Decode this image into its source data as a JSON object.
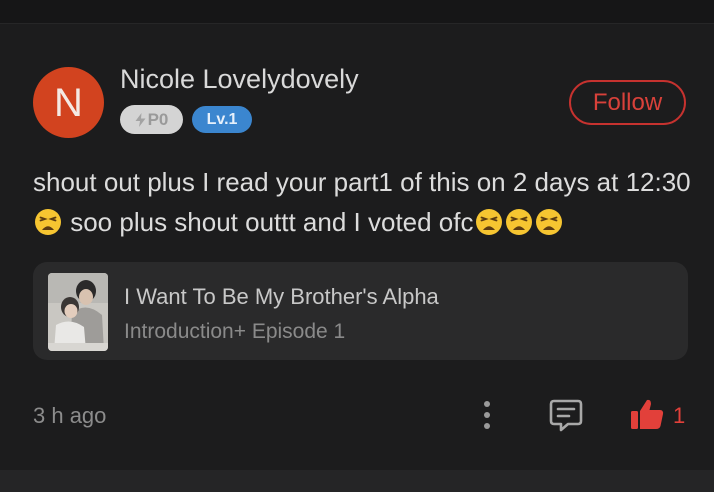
{
  "comment": {
    "avatar_letter": "N",
    "username": "Nicole Lovelydovely",
    "badges": {
      "points": "P0",
      "level": "Lv.1"
    },
    "follow_label": "Follow",
    "text_part1": "shout out plus I read your part1 of this on 2 days at 12:30",
    "text_part2": " soo plus shout outtt and I voted ofc",
    "emoji": "weary-face",
    "timestamp": "3 h ago",
    "likes": "1"
  },
  "story": {
    "title": "I Want To Be My Brother's Alpha",
    "episode": "Introduction+ Episode 1"
  },
  "colors": {
    "background": "#1c1c1d",
    "avatar": "#d2431f",
    "accent_red": "#d8413a",
    "level_badge": "#3b86cf",
    "card": "#2a2a2b"
  },
  "icons": [
    "lightning-icon",
    "more-vertical-icon",
    "reply-icon",
    "thumbs-up-icon",
    "weary-face-emoji"
  ]
}
